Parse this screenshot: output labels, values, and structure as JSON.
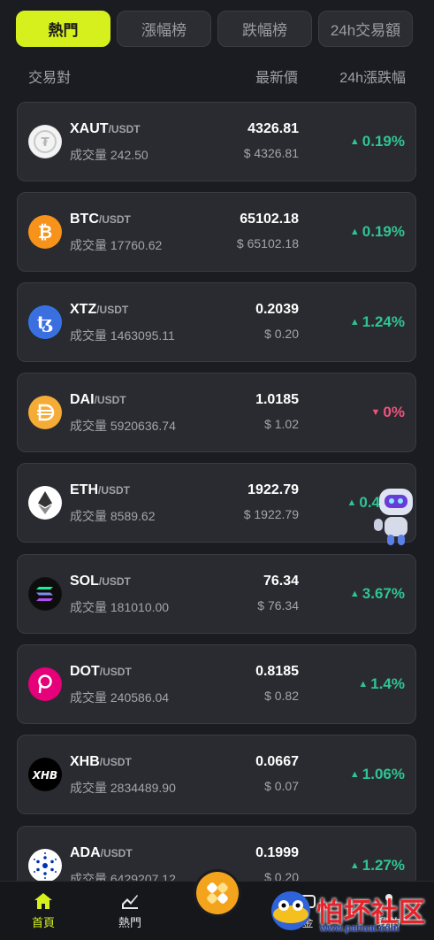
{
  "tabs": [
    {
      "label": "熱門",
      "active": true
    },
    {
      "label": "漲幅榜",
      "active": false
    },
    {
      "label": "跌幅榜",
      "active": false
    },
    {
      "label": "24h交易額",
      "active": false
    }
  ],
  "header": {
    "pair": "交易對",
    "price": "最新價",
    "change": "24h漲跌幅"
  },
  "rows": [
    {
      "base": "XAUT",
      "quote": "/USDT",
      "volume": "成交量 242.50",
      "price": "4326.81",
      "usd": "$ 4326.81",
      "change": "0.19%",
      "direction": "up",
      "icon": "xaut-coin-icon",
      "color": "#e6e6e6"
    },
    {
      "base": "BTC",
      "quote": "/USDT",
      "volume": "成交量 17760.62",
      "price": "65102.18",
      "usd": "$ 65102.18",
      "change": "0.19%",
      "direction": "up",
      "icon": "bitcoin-icon",
      "color": "#f7931a"
    },
    {
      "base": "XTZ",
      "quote": "/USDT",
      "volume": "成交量 1463095.11",
      "price": "0.2039",
      "usd": "$ 0.20",
      "change": "1.24%",
      "direction": "up",
      "icon": "tezos-icon",
      "color": "#2c7df7"
    },
    {
      "base": "DAI",
      "quote": "/USDT",
      "volume": "成交量 5920636.74",
      "price": "1.0185",
      "usd": "$ 1.02",
      "change": "0%",
      "direction": "down",
      "icon": "dai-icon",
      "color": "#f5ac37"
    },
    {
      "base": "ETH",
      "quote": "/USDT",
      "volume": "成交量 8589.62",
      "price": "1922.79",
      "usd": "$ 1922.79",
      "change": "0.4",
      "direction": "up",
      "icon": "ethereum-icon",
      "color": "#ffffff"
    },
    {
      "base": "SOL",
      "quote": "/USDT",
      "volume": "成交量 181010.00",
      "price": "76.34",
      "usd": "$ 76.34",
      "change": "3.67%",
      "direction": "up",
      "icon": "solana-icon",
      "color": "#111111"
    },
    {
      "base": "DOT",
      "quote": "/USDT",
      "volume": "成交量 240586.04",
      "price": "0.8185",
      "usd": "$ 0.82",
      "change": "1.4%",
      "direction": "up",
      "icon": "polkadot-icon",
      "color": "#e6007a"
    },
    {
      "base": "XHB",
      "quote": "/USDT",
      "volume": "成交量 2834489.90",
      "price": "0.0667",
      "usd": "$ 0.07",
      "change": "1.06%",
      "direction": "up",
      "icon": "xhb-icon",
      "color": "#000000"
    },
    {
      "base": "ADA",
      "quote": "/USDT",
      "volume": "成交量 6429207.12",
      "price": "0.1999",
      "usd": "$ 0.20",
      "change": "1.27%",
      "direction": "up",
      "icon": "cardano-icon",
      "color": "#ffffff"
    }
  ],
  "nav": {
    "home": "首頁",
    "hot": "熱門",
    "fund": "金",
    "mine": "我的"
  },
  "watermark": {
    "text": "怕坏社区",
    "url": "www.pahuai.com"
  },
  "colors": {
    "accent": "#d6f01d",
    "up": "#2ec592",
    "down": "#f0527c"
  }
}
